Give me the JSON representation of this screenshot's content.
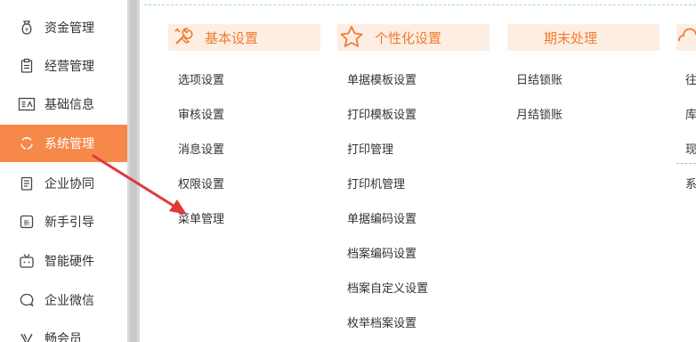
{
  "sidebar": {
    "items": [
      {
        "label": "资金管理",
        "icon": "money-bag-icon"
      },
      {
        "label": "经营管理",
        "icon": "clipboard-icon"
      },
      {
        "label": "基础信息",
        "icon": "id-card-icon"
      },
      {
        "label": "系统管理",
        "icon": "sync-circle-icon",
        "active": true
      },
      {
        "label": "企业协同",
        "icon": "document-icon"
      },
      {
        "label": "新手引导",
        "icon": "new-badge-icon"
      },
      {
        "label": "智能硬件",
        "icon": "tv-device-icon"
      },
      {
        "label": "企业微信",
        "icon": "chat-bubble-icon"
      },
      {
        "label": "畅会员",
        "icon": "vip-icon"
      }
    ]
  },
  "menu": {
    "columns": [
      {
        "title": "基本设置",
        "icon": "tools-icon",
        "items": [
          "选项设置",
          "审核设置",
          "消息设置",
          "权限设置",
          "菜单管理"
        ]
      },
      {
        "title": "个性化设置",
        "icon": "star-icon",
        "items": [
          "单据模板设置",
          "打印模板设置",
          "打印管理",
          "打印机管理",
          "单据编码设置",
          "档案编码设置",
          "档案自定义设置",
          "枚举档案设置"
        ]
      },
      {
        "title": "期末处理",
        "icon": "",
        "items": [
          "日结锁账",
          "月结锁账"
        ]
      },
      {
        "title": "",
        "icon": "cloud-icon",
        "items": [
          "往",
          "库",
          "现",
          "系"
        ]
      }
    ]
  },
  "colors": {
    "accent": "#f6894a",
    "header_bg": "#fdeee3",
    "header_text": "#f07c32",
    "arrow": "#e03a3a"
  }
}
